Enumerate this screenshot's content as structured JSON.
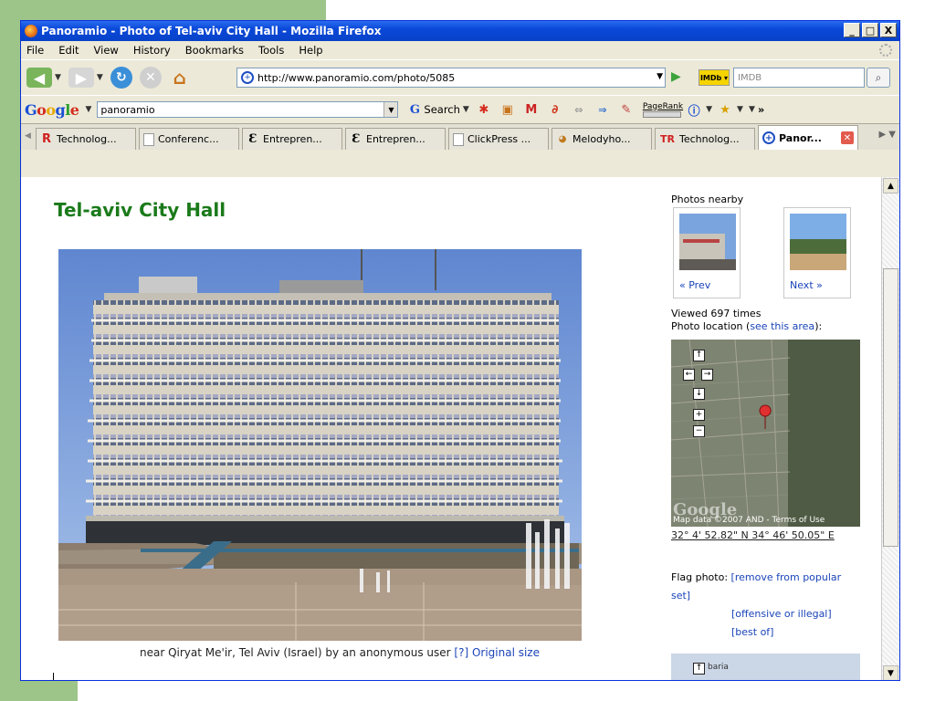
{
  "window": {
    "title": "Panoramio - Photo of Tel-aviv City Hall - Mozilla Firefox",
    "controls": {
      "minimize": "_",
      "maximize": "□",
      "close": "X"
    }
  },
  "menu": [
    "File",
    "Edit",
    "View",
    "History",
    "Bookmarks",
    "Tools",
    "Help"
  ],
  "nav": {
    "url": "http://www.panoramio.com/photo/5085",
    "search_placeholder": "IMDB"
  },
  "google_toolbar": {
    "logo": "Google",
    "query": "panoramio",
    "search_label": "Search",
    "pagerank_label": "PageRank",
    "more": "»"
  },
  "tabs": [
    {
      "label": "Technolog...",
      "icon": "R",
      "active": false
    },
    {
      "label": "Conferenc...",
      "icon": "page",
      "active": false
    },
    {
      "label": "Entrepren...",
      "icon": "E",
      "active": false
    },
    {
      "label": "Entrepren...",
      "icon": "E",
      "active": false
    },
    {
      "label": "ClickPress ...",
      "icon": "page",
      "active": false
    },
    {
      "label": "Melodyho...",
      "icon": "bird",
      "active": false
    },
    {
      "label": "Technolog...",
      "icon": "TR",
      "active": false
    },
    {
      "label": "Panor...",
      "icon": "panoramio",
      "active": true
    }
  ],
  "page": {
    "title": "Tel-aviv City Hall",
    "caption_text": "near Qiryat Me'ir, Tel Aviv (Israel) by an anonymous user",
    "caption_help": "[?]",
    "caption_original": "Original size"
  },
  "sidebar": {
    "nearby_label": "Photos nearby",
    "prev": "« Prev",
    "next": "Next »",
    "viewed": "Viewed 697 times",
    "location_prefix": "Photo location (",
    "location_link": "see this area",
    "location_suffix": "):",
    "map_attribution": "Map data ©2007 AND - Terms of Use",
    "map_logo": "Google",
    "coords": "32° 4' 52.82\" N 34° 46' 50.05\" E",
    "flag_label": "Flag photo:",
    "flag_remove": "[remove from popular set]",
    "flag_offensive": "[offensive or illegal]",
    "flag_best": "[best of]",
    "minimap_label": "baria"
  },
  "colors": {
    "title_green": "#1a7a1a",
    "link_blue": "#1a44b8",
    "slide_green": "#9dc58a"
  }
}
